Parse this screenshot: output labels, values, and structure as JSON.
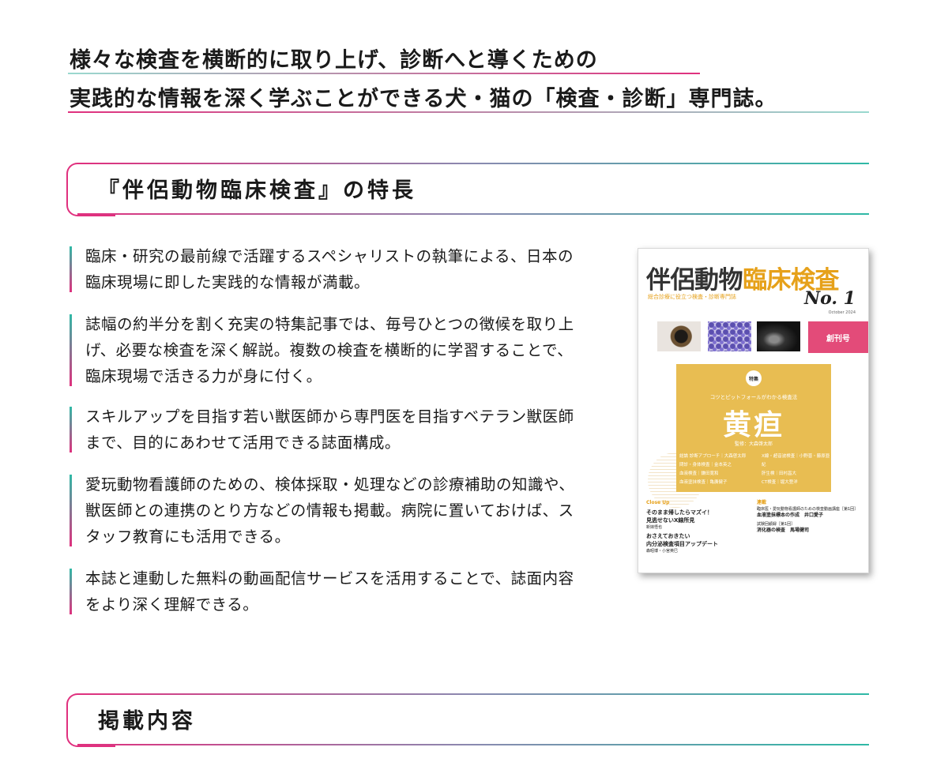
{
  "intro": {
    "line1": "様々な検査を横断的に取り上げ、診断へと導くための",
    "line2": "実践的な情報を深く学ぶことができる犬・猫の「検査・診断」専門誌。"
  },
  "features_section": {
    "title": "『伴侶動物臨床検査』の特長"
  },
  "features": [
    {
      "text": "臨床・研究の最前線で活躍するスペシャリストの執筆による、日本の臨床現場に即した実践的な情報が満載。"
    },
    {
      "text": "誌幅の約半分を割く充実の特集記事では、毎号ひとつの徴候を取り上げ、必要な検査を深く解説。複数の検査を横断的に学習することで、臨床現場で活きる力が身に付く。"
    },
    {
      "text": "スキルアップを目指す若い獣医師から専門医を目指すベテラン獣医師まで、目的にあわせて活用できる誌面構成。"
    },
    {
      "text": "愛玩動物看護師のための、検体採取・処理などの診療補助の知識や、獣医師との連携のとり方などの情報も掲載。病院に置いておけば、スタッフ教育にも活用できる。"
    },
    {
      "text": "本誌と連動した無料の動画配信サービスを活用することで、誌面内容をより深く理解できる。"
    }
  ],
  "cover": {
    "title_main": "伴侶動物",
    "title_accent": "臨床検査",
    "subtitle": "総合診療に役立つ検査・診断専門誌",
    "issue": "No. 1",
    "date": "October 2024",
    "badge": "創刊号",
    "special_tag": "特集",
    "special_kicker": "コツとピットフォールがわかる検査法",
    "special_title": "黄疸",
    "special_editor": "監修：大森啓太郎",
    "toc_left": [
      "総論 診断アプローチ｜大森啓太郎",
      "問診・身体検査｜金本英之",
      "血液検査｜鎌田寛和",
      "血液塗抹検査｜亀廣健子"
    ],
    "toc_right": [
      "X線・超音波検査｜小野晋・藤原亜紀",
      "肝生検｜田村昌大",
      "CT検査｜堀大登洋"
    ],
    "closeup_label": "Close Up",
    "closeup_items": [
      "そのまま帰したらマズイ！",
      "見逃せないX線所見",
      "新妹悟也",
      "おさえておきたい",
      "内分泌検査項目アップデート",
      "森昭博・小宮英巳"
    ],
    "serial_label": "連載",
    "serial_items": [
      "臨床医・愛玩動物看護師のための検査動画講座［第1回］",
      "血液塗抹標本の作成　井口愛子",
      "試験回顧録［第1回］",
      "消化器の検査　馬場健司"
    ]
  },
  "contents_section": {
    "title": "掲載内容"
  },
  "colors": {
    "accent_pink": "#e0307e",
    "accent_teal": "#2fb9a6",
    "cover_yellow": "#e8bd52",
    "badge_pink": "#e34b79"
  }
}
